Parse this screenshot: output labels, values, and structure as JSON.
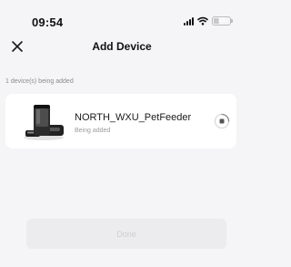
{
  "status_bar": {
    "time": "09:54",
    "battery": "33"
  },
  "header": {
    "title": "Add Device"
  },
  "section": {
    "label": "1 device(s) being added"
  },
  "devices": [
    {
      "name": "NORTH_WXU_PetFeeder",
      "status": "Being added"
    }
  ],
  "footer": {
    "done_label": "Done"
  },
  "icons": {
    "close": "close-icon",
    "progress": "progress-ring-icon",
    "device_image": "pet-feeder-image"
  }
}
